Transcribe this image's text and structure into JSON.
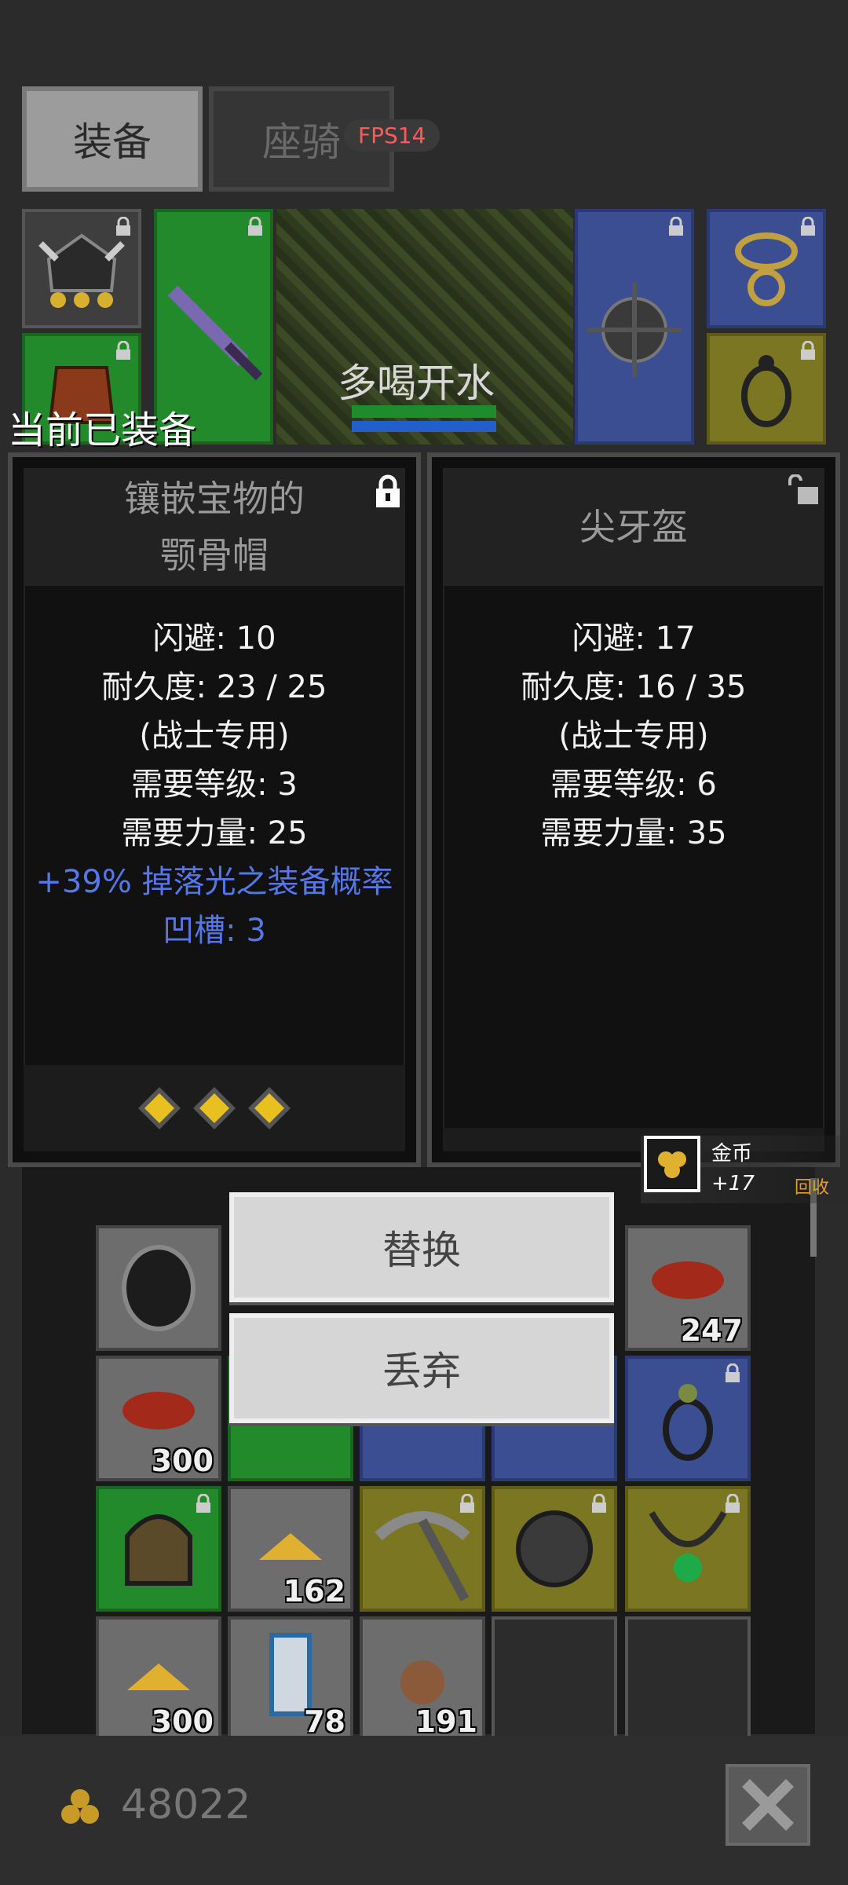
{
  "tabs": {
    "equipment": "装备",
    "mount": "座骑"
  },
  "fps": "FPS14",
  "player": {
    "name": "多喝开水"
  },
  "current_equipped_label": "当前已装备",
  "compare": {
    "equipped": {
      "title_line1": "镶嵌宝物的",
      "title_line2": "颚骨帽",
      "stats": [
        "闪避: 10",
        "耐久度: 23 / 25",
        "(战士专用)",
        "需要等级: 3",
        "需要力量: 25"
      ],
      "bonus_stats": [
        "+39% 掉落光之装备概率",
        "凹槽: 3"
      ],
      "locked": true,
      "gems": 3
    },
    "candidate": {
      "title": "尖牙盔",
      "stats": [
        "闪避: 17",
        "耐久度: 16 / 35",
        "(战士专用)",
        "需要等级: 6",
        "需要力量: 35"
      ],
      "locked": false
    }
  },
  "actions": {
    "replace": "替换",
    "discard": "丢弃"
  },
  "coin_toast": {
    "name": "金币",
    "amount": "+17",
    "recycle": "回收"
  },
  "inventory_counts": {
    "meat1": "247",
    "meat2": "300",
    "gold_pile1": "162",
    "gold_pile2": "300",
    "scroll": "78",
    "ore": "191"
  },
  "footer": {
    "gold": "48022"
  },
  "colors": {
    "rarity_green": "#238a2c",
    "rarity_blue": "#3c4e92",
    "rarity_yellow": "#7b7622",
    "fps_red": "#ff5a5a",
    "bonus_blue": "#5577e8"
  }
}
